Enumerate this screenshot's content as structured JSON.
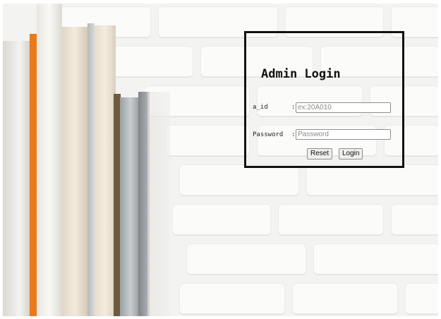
{
  "login": {
    "title": "Admin Login",
    "id_label": "a_id",
    "id_colon": ":",
    "id_placeholder": "ex:20A010",
    "password_label": "Password",
    "password_colon": ":",
    "password_placeholder": "Password",
    "reset_label": "Reset",
    "login_label": "Login"
  },
  "colors": {
    "panel_border": "#111111",
    "wall": "#f3f3f1"
  }
}
